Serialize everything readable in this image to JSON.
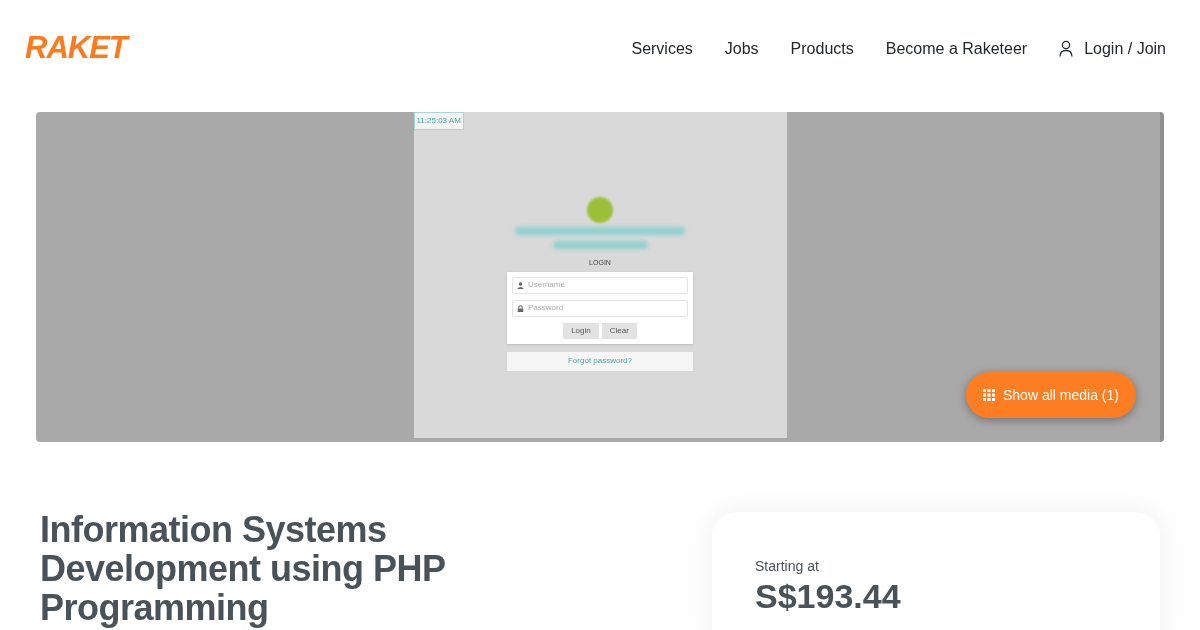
{
  "header": {
    "logo": "RAKET",
    "nav": [
      {
        "label": "Services"
      },
      {
        "label": "Jobs"
      },
      {
        "label": "Products"
      },
      {
        "label": "Become a Raketeer"
      }
    ],
    "account_link": "Login / Join"
  },
  "media": {
    "screenshot": {
      "time": "11:25:03 AM",
      "panel_title": "LOGIN",
      "fields": [
        {
          "kind": "user",
          "placeholder": "Username"
        },
        {
          "kind": "lock",
          "placeholder": "Password"
        }
      ],
      "buttons": [
        "Login",
        "Clear"
      ],
      "forgot_link": "Forgot password?"
    },
    "show_all_button": "Show all media (1)"
  },
  "listing": {
    "title": "Information Systems Development using PHP Programming",
    "price_label": "Starting at",
    "price": "S$193.44"
  }
}
